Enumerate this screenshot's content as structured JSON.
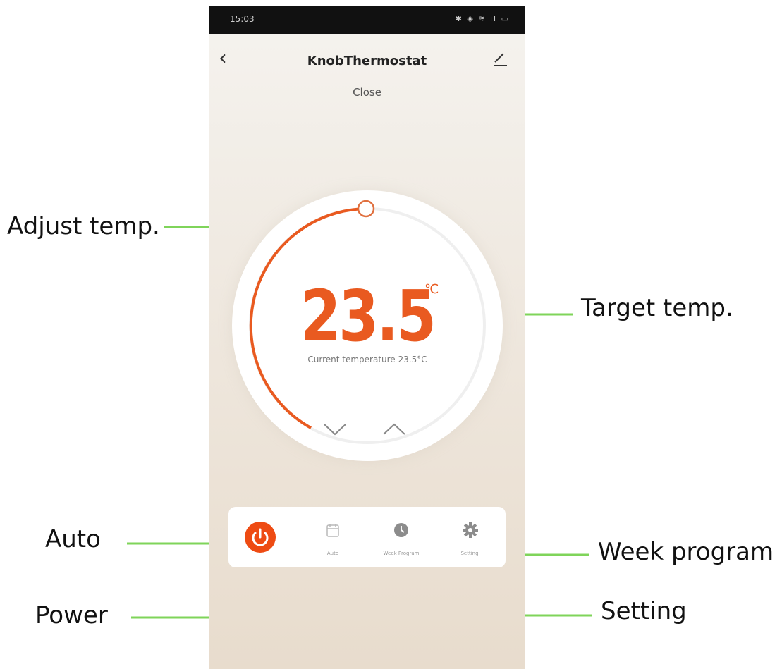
{
  "status_bar": {
    "time": "15:03",
    "icons": "✱ ◈ ≋ ıl ▭"
  },
  "header": {
    "title": "KnobThermostat",
    "subtitle": "Close",
    "back_icon": "chevron-left-icon",
    "edit_icon": "pencil-icon"
  },
  "dial": {
    "target_temp": "23.5",
    "unit": "℃",
    "current_temp_text": "Current temperature 23.5°C",
    "accent": "#e95a20",
    "down_icon": "chevron-down-icon",
    "up_icon": "chevron-up-icon"
  },
  "bottom_bar": {
    "items": [
      {
        "label": "",
        "icon": "power-icon",
        "color": "#ee4b13"
      },
      {
        "label": "Auto",
        "icon": "calendar-icon"
      },
      {
        "label": "Week Program",
        "icon": "clock-icon"
      },
      {
        "label": "Setting",
        "icon": "gear-icon"
      }
    ]
  },
  "annotations": {
    "adjust_temp": "Adjust temp.",
    "target_temp": "Target temp.",
    "auto": "Auto",
    "week_program": "Week program",
    "power": "Power",
    "setting": "Setting",
    "line_color": "#7fd45a"
  }
}
